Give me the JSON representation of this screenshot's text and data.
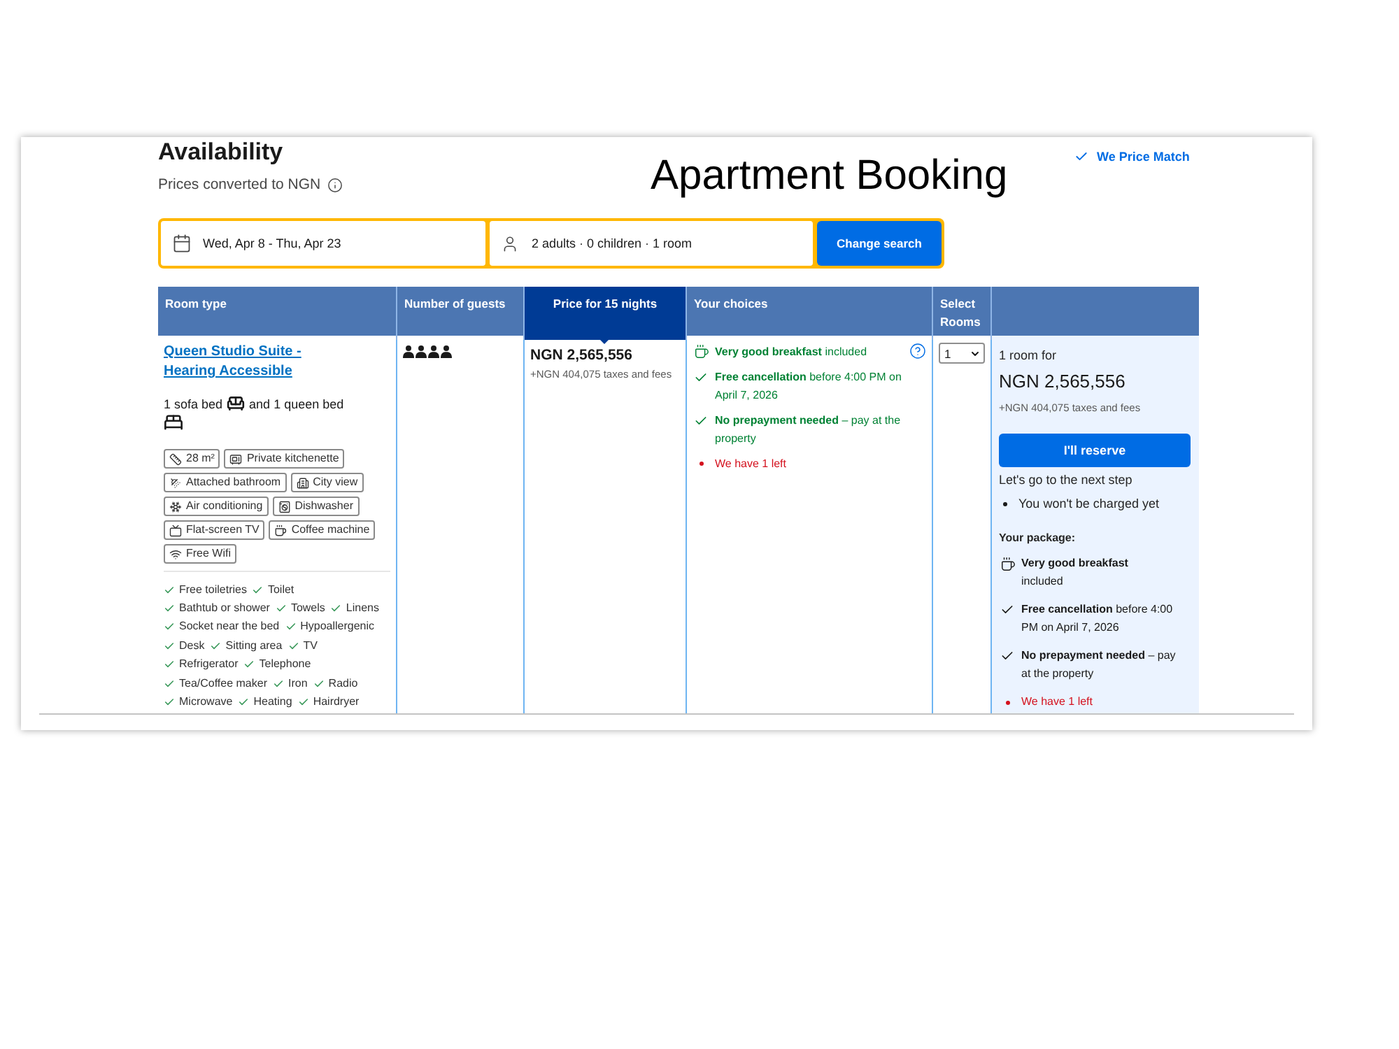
{
  "page_title": "Apartment Booking",
  "header": {
    "heading": "Availability",
    "currency_note": "Prices converted to NGN",
    "price_match": "We Price Match"
  },
  "search": {
    "dates": "Wed, Apr 8 - Thu, Apr 23",
    "guests": "2 adults · 0 children · 1 room",
    "button": "Change search"
  },
  "table": {
    "columns": [
      {
        "label": "Room type",
        "highlighted": false
      },
      {
        "label": "Number of guests",
        "highlighted": false
      },
      {
        "label": "Price for 15 nights",
        "highlighted": true
      },
      {
        "label": "Your choices",
        "highlighted": false
      },
      {
        "label": "Select Rooms",
        "highlighted": false
      }
    ],
    "rows": [
      {
        "room_name": "Queen Studio Suite - Hearing Accessible",
        "beds": [
          {
            "label": "1 sofa bed",
            "kind": "sofa"
          },
          {
            "label": "and 1 queen bed",
            "kind": "double"
          }
        ],
        "facilities": [
          {
            "label": "28 m²",
            "kind": "size"
          },
          {
            "label": "Private kitchenette",
            "kind": "kitchenette"
          },
          {
            "label": "Attached bathroom",
            "kind": "bathroom"
          },
          {
            "label": "City view",
            "kind": "view"
          },
          {
            "label": "Air conditioning",
            "kind": "air_conditioning"
          },
          {
            "label": "Dishwasher",
            "kind": "dishwasher"
          },
          {
            "label": "Flat-screen TV",
            "kind": "tv"
          },
          {
            "label": "Coffee machine",
            "kind": "coffee_machine"
          },
          {
            "label": "Free Wifi",
            "kind": "wifi"
          }
        ],
        "amenities": [
          "Free toiletries",
          "Toilet",
          "Bathtub or shower",
          "Towels",
          "Linens",
          "Socket near the bed",
          "Hypoallergenic",
          "Desk",
          "Sitting area",
          "TV",
          "Refrigerator",
          "Telephone",
          "Tea/Coffee maker",
          "Iron",
          "Radio",
          "Microwave",
          "Heating",
          "Hairdryer"
        ],
        "guests": [
          {
            "kind": "person"
          },
          {
            "kind": "person"
          },
          {
            "kind": "person"
          },
          {
            "kind": "person"
          }
        ],
        "price": "NGN 2,565,556",
        "taxes": "+NGN 404,075 taxes and fees",
        "choices": [
          {
            "kind": "meal",
            "title": "Very good breakfast",
            "detail": "included",
            "help": true
          },
          {
            "kind": "check",
            "title": "Free cancellation",
            "detail": "before 4:00 PM on April 7, 2026",
            "help": false
          },
          {
            "kind": "check",
            "title": "No prepayment needed",
            "detail": "– pay at the property",
            "help": false
          },
          {
            "kind": "alert",
            "detail": "We have 1 left",
            "help": false
          }
        ],
        "rooms_selected": "1"
      }
    ]
  },
  "summary": {
    "rooms_for": "1 room for",
    "price": "NGN 2,565,556",
    "taxes": "+NGN 404,075 taxes and fees",
    "button": "I'll reserve",
    "next_step": "Let's go to the next step",
    "notes": [
      "You won't be charged yet"
    ],
    "package_title": "Your package:",
    "package": [
      {
        "kind": "meal",
        "title": "Very good breakfast",
        "detail": "included"
      },
      {
        "kind": "check",
        "title": "Free cancellation",
        "detail": "before 4:00 PM on April 7, 2026"
      },
      {
        "kind": "check",
        "title": "No prepayment needed",
        "detail": "– pay at the property"
      },
      {
        "kind": "alert",
        "detail": "We have 1 left"
      }
    ]
  }
}
